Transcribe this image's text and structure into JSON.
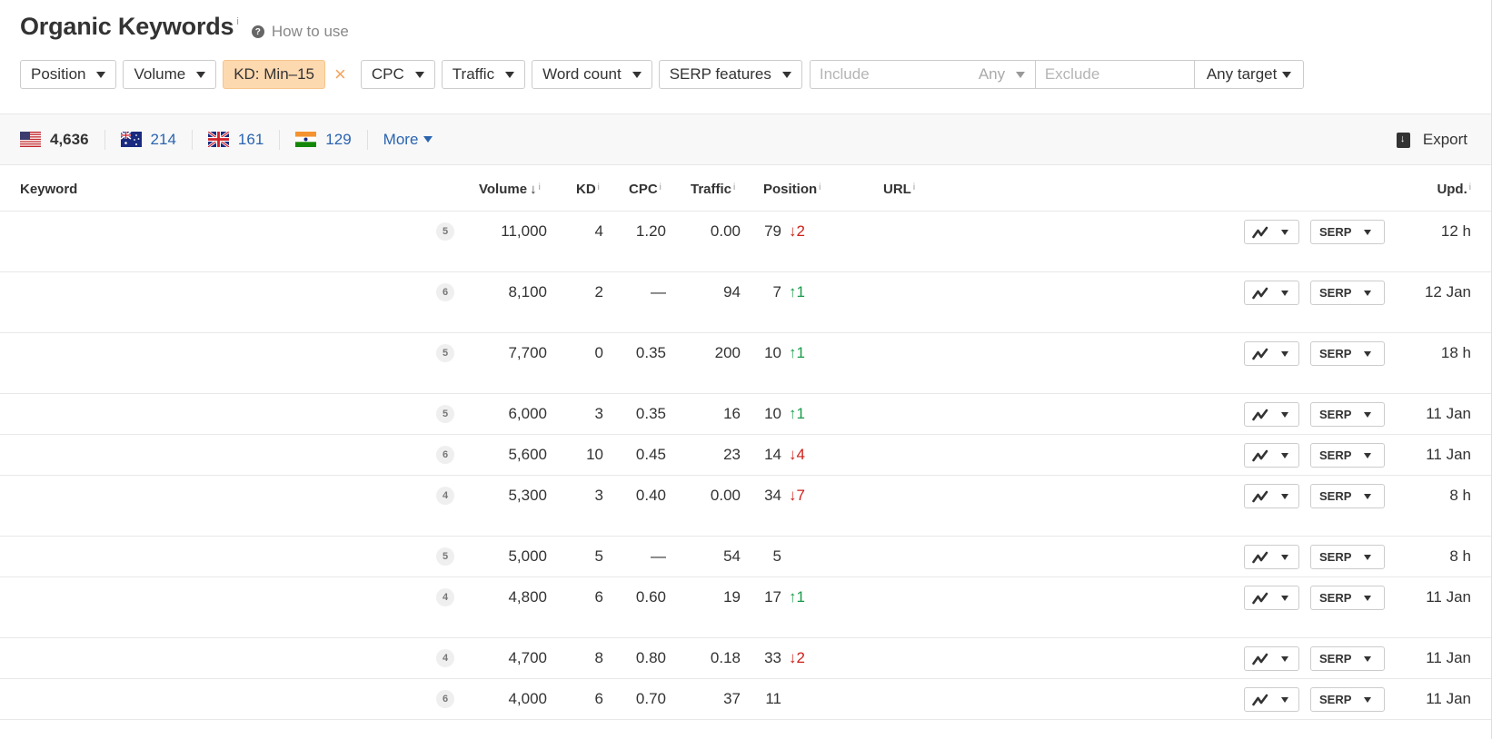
{
  "header": {
    "title": "Organic Keywords",
    "title_info": "i",
    "how_to_use": "How to use"
  },
  "filters": {
    "position": "Position",
    "volume": "Volume",
    "kd": "KD: Min–15",
    "kd_clear": "×",
    "cpc": "CPC",
    "traffic": "Traffic",
    "word_count": "Word count",
    "serp_features": "SERP features",
    "include_placeholder": "Include",
    "any": "Any",
    "exclude_placeholder": "Exclude",
    "any_target": "Any target"
  },
  "countries": [
    {
      "flag": "us-flag",
      "count": "4,636"
    },
    {
      "flag": "au-flag",
      "count": "214"
    },
    {
      "flag": "gb-flag",
      "count": "161"
    },
    {
      "flag": "in-flag",
      "count": "129"
    }
  ],
  "more_label": "More",
  "export_label": "Export",
  "columns": {
    "keyword": "Keyword",
    "volume": "Volume",
    "volume_sort": "↓",
    "kd": "KD",
    "cpc": "CPC",
    "traffic": "Traffic",
    "position": "Position",
    "url": "URL",
    "upd": "Upd.",
    "info": "i"
  },
  "serp_label": "SERP",
  "rows": [
    {
      "words": "5",
      "volume": "11,000",
      "kd": "4",
      "cpc": "1.20",
      "traffic": "0.00",
      "position": "79",
      "change_dir": "down",
      "change": "↓2",
      "upd": "12 h"
    },
    {
      "words": "6",
      "volume": "8,100",
      "kd": "2",
      "cpc": "—",
      "traffic": "94",
      "position": "7",
      "change_dir": "up",
      "change": "↑1",
      "upd": "12 Jan"
    },
    {
      "words": "5",
      "volume": "7,700",
      "kd": "0",
      "cpc": "0.35",
      "traffic": "200",
      "position": "10",
      "change_dir": "up",
      "change": "↑1",
      "upd": "18 h"
    },
    {
      "words": "5",
      "volume": "6,000",
      "kd": "3",
      "cpc": "0.35",
      "traffic": "16",
      "position": "10",
      "change_dir": "up",
      "change": "↑1",
      "upd": "11 Jan"
    },
    {
      "words": "6",
      "volume": "5,600",
      "kd": "10",
      "cpc": "0.45",
      "traffic": "23",
      "position": "14",
      "change_dir": "down",
      "change": "↓4",
      "upd": "11 Jan"
    },
    {
      "words": "4",
      "volume": "5,300",
      "kd": "3",
      "cpc": "0.40",
      "traffic": "0.00",
      "position": "34",
      "change_dir": "down",
      "change": "↓7",
      "upd": "8 h"
    },
    {
      "words": "5",
      "volume": "5,000",
      "kd": "5",
      "cpc": "—",
      "traffic": "54",
      "position": "5",
      "change_dir": "none",
      "change": "",
      "upd": "8 h"
    },
    {
      "words": "4",
      "volume": "4,800",
      "kd": "6",
      "cpc": "0.60",
      "traffic": "19",
      "position": "17",
      "change_dir": "up",
      "change": "↑1",
      "upd": "11 Jan"
    },
    {
      "words": "4",
      "volume": "4,700",
      "kd": "8",
      "cpc": "0.80",
      "traffic": "0.18",
      "position": "33",
      "change_dir": "down",
      "change": "↓2",
      "upd": "11 Jan"
    },
    {
      "words": "6",
      "volume": "4,000",
      "kd": "6",
      "cpc": "0.70",
      "traffic": "37",
      "position": "11",
      "change_dir": "none",
      "change": "",
      "upd": "11 Jan"
    }
  ]
}
